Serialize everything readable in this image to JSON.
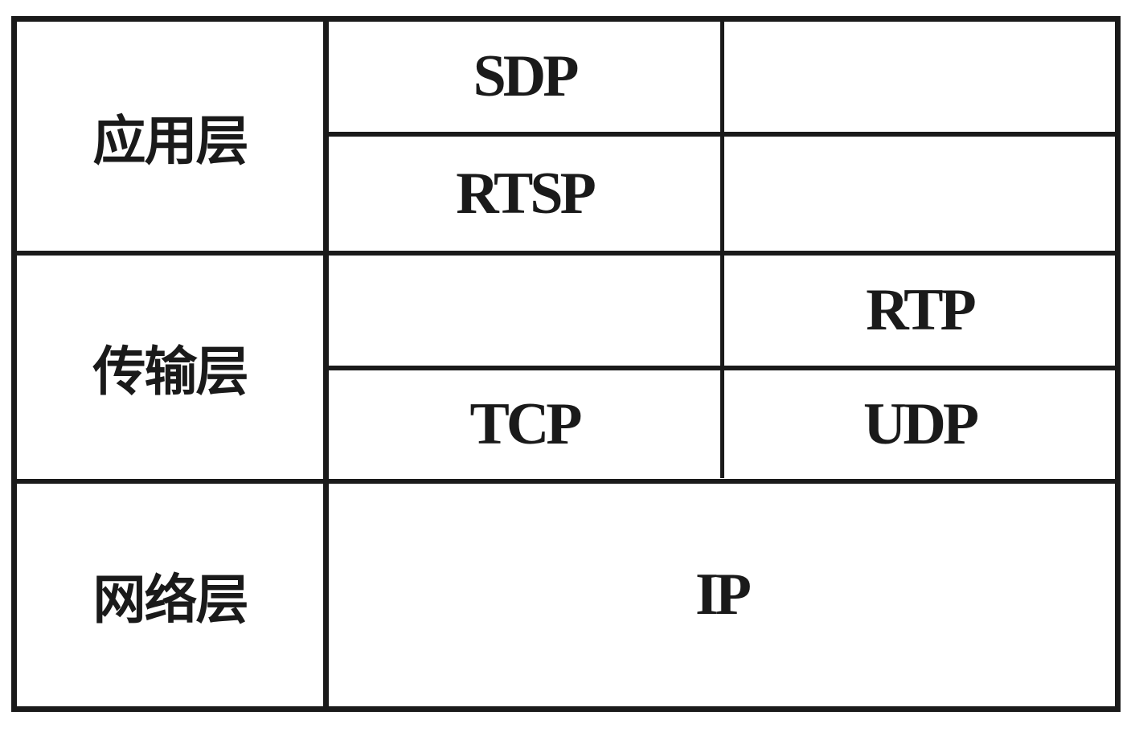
{
  "layers": {
    "application": "应用层",
    "transport": "传输层",
    "network": "网络层"
  },
  "protocols": {
    "sdp": "SDP",
    "rtsp": "RTSP",
    "rtp": "RTP",
    "tcp": "TCP",
    "udp": "UDP",
    "ip": "IP"
  },
  "colors": {
    "line": "#1a1a1a",
    "background": "#ffffff"
  }
}
